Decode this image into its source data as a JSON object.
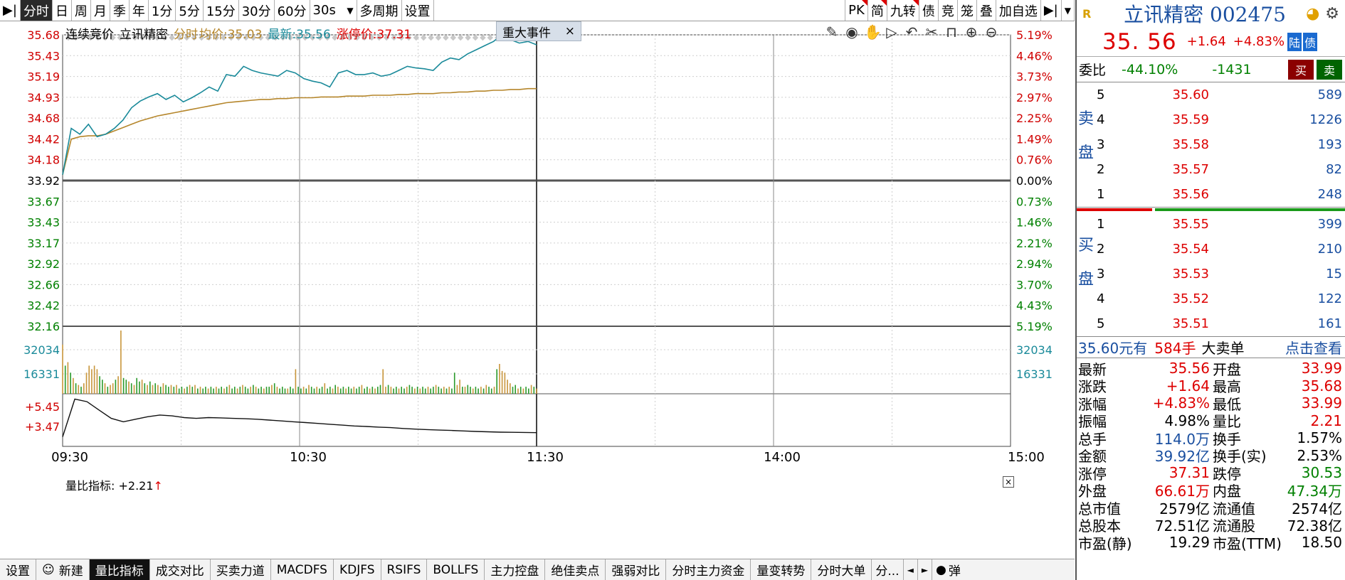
{
  "toolbar": {
    "left_items": [
      "分时",
      "日",
      "周",
      "月",
      "季",
      "年",
      "1分",
      "5分",
      "15分",
      "30分",
      "60分",
      "30s",
      "多周期",
      "设置"
    ],
    "right_items": [
      "PK",
      "简",
      "九转",
      "债",
      "竞",
      "笼",
      "叠",
      "加自选"
    ]
  },
  "chart_header": {
    "session": "连续竞价",
    "name": "立讯精密",
    "mode": "分时",
    "avg_label": "均价:35.03",
    "latest_label": "最新:35.56",
    "limit_label": "涨停价:37.31",
    "event_tab": "重大事件",
    "event_close": "×"
  },
  "volume_indicator": {
    "label": "量比指标:",
    "value": "+2.21",
    "arrow": "↑",
    "close": "×"
  },
  "bottom_tabs": [
    "设置",
    "新建",
    "量比指标",
    "成交对比",
    "买卖力道",
    "MACDFS",
    "KDJFS",
    "RSIFS",
    "BOLLFS",
    "主力控盘",
    "绝佳卖点",
    "强弱对比",
    "分时主力资金",
    "量变转势",
    "分时大单",
    "分..."
  ],
  "bottom_controls": {
    "prev": "◄",
    "next": "►",
    "bullet": "弹"
  },
  "colors": {
    "price_line": "#1a8a9a",
    "avg_line": "#b5862b",
    "up": "#d00000",
    "down": "#008000",
    "axis_blue": "#1a8a9a",
    "grid": "#cfcfcf"
  },
  "chart_data": {
    "type": "line",
    "price_axis_left": [
      "35.68",
      "35.43",
      "35.19",
      "34.93",
      "34.68",
      "34.42",
      "34.18",
      "33.92",
      "33.67",
      "33.43",
      "33.17",
      "32.92",
      "32.66",
      "32.42",
      "32.16"
    ],
    "pct_axis_right": [
      "5.19%",
      "4.46%",
      "3.73%",
      "2.97%",
      "2.25%",
      "1.49%",
      "0.76%",
      "0.00%",
      "0.73%",
      "1.46%",
      "2.21%",
      "2.94%",
      "3.70%",
      "4.43%",
      "5.19%"
    ],
    "base_price": 33.92,
    "ylim": [
      32.16,
      35.68
    ],
    "volume_axis": [
      "32034",
      "16331"
    ],
    "ratio_axis": [
      "+5.45",
      "+3.47"
    ],
    "time_labels": [
      "09:30",
      "10:30",
      "11:30",
      "14:00",
      "15:00"
    ],
    "price_series": [
      33.99,
      34.55,
      34.48,
      34.6,
      34.45,
      34.48,
      34.55,
      34.65,
      34.8,
      34.88,
      34.93,
      34.97,
      34.9,
      34.95,
      34.87,
      34.92,
      34.98,
      35.05,
      35.0,
      35.2,
      35.18,
      35.3,
      35.25,
      35.22,
      35.2,
      35.18,
      35.25,
      35.22,
      35.15,
      35.12,
      35.1,
      35.05,
      35.22,
      35.25,
      35.2,
      35.2,
      35.22,
      35.18,
      35.2,
      35.25,
      35.3,
      35.28,
      35.27,
      35.25,
      35.35,
      35.4,
      35.38,
      35.45,
      35.5,
      35.55,
      35.6,
      35.68,
      35.62,
      35.58,
      35.6,
      35.56
    ],
    "avg_series": [
      33.99,
      34.42,
      34.45,
      34.46,
      34.46,
      34.48,
      34.52,
      34.56,
      34.6,
      34.64,
      34.67,
      34.7,
      34.72,
      34.74,
      34.76,
      34.78,
      34.8,
      34.82,
      34.84,
      34.86,
      34.87,
      34.88,
      34.89,
      34.9,
      34.9,
      34.91,
      34.91,
      34.92,
      34.92,
      34.92,
      34.93,
      34.93,
      34.93,
      34.94,
      34.94,
      34.94,
      34.95,
      34.95,
      34.95,
      34.96,
      34.96,
      34.97,
      34.97,
      34.97,
      34.98,
      34.98,
      34.99,
      34.99,
      35.0,
      35.0,
      35.01,
      35.01,
      35.02,
      35.02,
      35.03,
      35.03
    ],
    "volume_series": [
      28000,
      16000,
      18000,
      12000,
      9000,
      6000,
      5000,
      4000,
      6000,
      12000,
      16000,
      14000,
      16000,
      14000,
      10000,
      8000,
      6000,
      4000,
      5000,
      6000,
      8000,
      10000,
      36000,
      9000,
      8000,
      7000,
      6000,
      5000,
      9000,
      7000,
      8000,
      6000,
      5000,
      7000,
      5000,
      6000,
      5000,
      4000,
      6000,
      5000,
      4000,
      5000,
      4000,
      5000,
      3000,
      4000,
      3000,
      4000,
      5000,
      4000,
      5000,
      3000,
      4000,
      3000,
      4000,
      3000,
      4000,
      3000,
      4000,
      3000,
      4000,
      3000,
      4000,
      5000,
      3000,
      4000,
      3000,
      4000,
      5000,
      4000,
      3000,
      4000,
      5000,
      4000,
      3000,
      4000,
      3000,
      4000,
      4000,
      5000,
      6000,
      4000,
      3000,
      4000,
      3000,
      3000,
      4000,
      3000,
      14000,
      4000,
      3000,
      4000,
      3000,
      5000,
      4000,
      3000,
      4000,
      3000,
      4000,
      6000,
      3000,
      4000,
      3000,
      5000,
      4000,
      3000,
      4000,
      3000,
      4000,
      3000,
      4000,
      3000,
      4000,
      5000,
      3000,
      4000,
      3000,
      4000,
      3000,
      4000,
      5000,
      14000,
      4000,
      5000,
      4000,
      3000,
      4000,
      3000,
      4000,
      3000,
      4000,
      5000,
      4000,
      3000,
      4000,
      3000,
      4000,
      3000,
      4000,
      3000,
      4000,
      5000,
      4000,
      3000,
      4000,
      3000,
      4000,
      3000,
      12000,
      5000,
      8000,
      4000,
      4000,
      5000,
      4000,
      3000,
      4000,
      3000,
      4000,
      3000,
      5000,
      4000,
      3000,
      4000,
      14000,
      17000,
      13000,
      12000,
      8000,
      6000,
      4000,
      5000,
      3000,
      4000,
      3000,
      4000,
      3000,
      5000,
      4000,
      3000
    ],
    "volume_up_flags": [
      1,
      0,
      1,
      0,
      1,
      0,
      1,
      0,
      1,
      1,
      1,
      1,
      1,
      1,
      0,
      0,
      1,
      0,
      1,
      1,
      0,
      1,
      1,
      0,
      0,
      1,
      0,
      1,
      0,
      0,
      1,
      0,
      1,
      0,
      1,
      0,
      1,
      0,
      1,
      0,
      0,
      1,
      0,
      1,
      0,
      0,
      1,
      0,
      1,
      0,
      1,
      0,
      1,
      0,
      0,
      1,
      0,
      0,
      1,
      0,
      0,
      1,
      0,
      1,
      0,
      0,
      1,
      0,
      1,
      0,
      0,
      1,
      0,
      1,
      0,
      0,
      1,
      0,
      0,
      1,
      0,
      1,
      0,
      0,
      0,
      1,
      0,
      0,
      1,
      0,
      0,
      1,
      0,
      1,
      0,
      0,
      1,
      0,
      0,
      1,
      0,
      0,
      1,
      0,
      1,
      0,
      0,
      1,
      0,
      0,
      1,
      0,
      0,
      1,
      0,
      0,
      1,
      0,
      1,
      0,
      0,
      1,
      1,
      0,
      1,
      0,
      0,
      1,
      0,
      0,
      1,
      0,
      0,
      1,
      0,
      1,
      0,
      0,
      1,
      0,
      0,
      1,
      0,
      0,
      1,
      0,
      1,
      0,
      0,
      1,
      1,
      0,
      1,
      0,
      0,
      1,
      0,
      0,
      1,
      0,
      1,
      0,
      0,
      1,
      0,
      1,
      1,
      1,
      1,
      1,
      0,
      0,
      1,
      0,
      1,
      0,
      0,
      1,
      0,
      1,
      0,
      0
    ],
    "ratio_series": [
      3.2,
      5.45,
      5.3,
      4.8,
      4.3,
      4.1,
      4.25,
      4.4,
      4.5,
      4.45,
      4.35,
      4.3,
      4.35,
      4.33,
      4.3,
      4.28,
      4.25,
      4.2,
      4.15,
      4.1,
      4.05,
      4.0,
      3.95,
      3.9,
      3.85,
      3.82,
      3.78,
      3.75,
      3.7,
      3.66,
      3.63,
      3.6,
      3.58,
      3.55,
      3.52,
      3.5,
      3.48,
      3.47,
      3.46,
      3.45
    ]
  },
  "right_panel": {
    "logo": "R",
    "stock_name": "立讯精密 002475",
    "last_price": "35. 56",
    "change": "+1.64",
    "change_pct": "+4.83%",
    "tag_lu": "陆",
    "tag_zhai": "债",
    "weibi_label": "委比",
    "weibi_pct": "-44.10%",
    "weibi_diff": "-1431",
    "buy_btn": "买",
    "sell_btn": "卖",
    "sell_label": "卖盘",
    "buy_label": "买盘",
    "sell_book": [
      {
        "level": "5",
        "price": "35.60",
        "qty": "589"
      },
      {
        "level": "4",
        "price": "35.59",
        "qty": "1226"
      },
      {
        "level": "3",
        "price": "35.58",
        "qty": "193"
      },
      {
        "level": "2",
        "price": "35.57",
        "qty": "82"
      },
      {
        "level": "1",
        "price": "35.56",
        "qty": "248"
      }
    ],
    "buy_book": [
      {
        "level": "1",
        "price": "35.55",
        "qty": "399"
      },
      {
        "level": "2",
        "price": "35.54",
        "qty": "210"
      },
      {
        "level": "3",
        "price": "35.53",
        "qty": "15"
      },
      {
        "level": "4",
        "price": "35.52",
        "qty": "122"
      },
      {
        "level": "5",
        "price": "35.51",
        "qty": "161"
      }
    ],
    "big_order": {
      "price": "35.60元有",
      "volume": "584手",
      "text": "大卖单",
      "link": "点击查看"
    },
    "stats": [
      {
        "k1": "最新",
        "v1": "35.56",
        "c1": "red",
        "k2": "开盘",
        "v2": "33.99",
        "c2": "red"
      },
      {
        "k1": "涨跌",
        "v1": "+1.64",
        "c1": "red",
        "k2": "最高",
        "v2": "35.68",
        "c2": "red"
      },
      {
        "k1": "涨幅",
        "v1": "+4.83%",
        "c1": "red",
        "k2": "最低",
        "v2": "33.99",
        "c2": "red"
      },
      {
        "k1": "振幅",
        "v1": "4.98%",
        "c1": "",
        "k2": "量比",
        "v2": "2.21",
        "c2": "red"
      },
      {
        "k1": "总手",
        "v1": "114.0万",
        "c1": "blue",
        "k2": "换手",
        "v2": "1.57%",
        "c2": ""
      },
      {
        "k1": "金额",
        "v1": "39.92亿",
        "c1": "blue",
        "k2": "换手(实)",
        "v2": "2.53%",
        "c2": ""
      },
      {
        "k1": "涨停",
        "v1": "37.31",
        "c1": "red",
        "k2": "跌停",
        "v2": "30.53",
        "c2": "green"
      },
      {
        "k1": "外盘",
        "v1": "66.61万",
        "c1": "red",
        "k2": "内盘",
        "v2": "47.34万",
        "c2": "green"
      },
      {
        "k1": "总市值",
        "v1": "2579亿",
        "c1": "",
        "k2": "流通值",
        "v2": "2574亿",
        "c2": ""
      },
      {
        "k1": "总股本",
        "v1": "72.51亿",
        "c1": "",
        "k2": "流通股",
        "v2": "72.38亿",
        "c2": ""
      },
      {
        "k1": "市盈(静)",
        "v1": "19.29",
        "c1": "",
        "k2": "市盈(TTM)",
        "v2": "18.50",
        "c2": ""
      }
    ]
  }
}
